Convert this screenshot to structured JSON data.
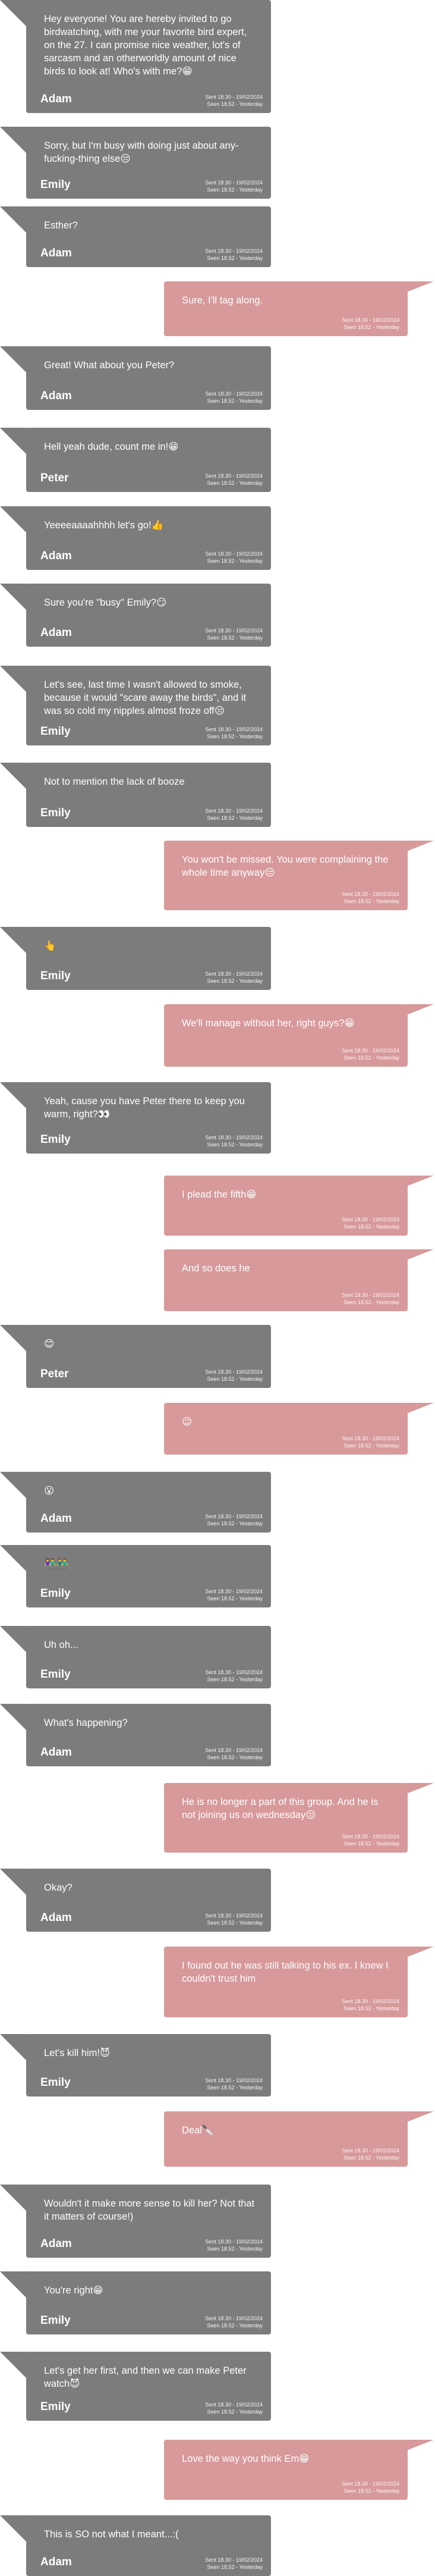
{
  "chat": {
    "messages": [
      {
        "dir": "in",
        "sender": "Adam",
        "text": "Hey everyone! You are hereby invited to go birdwatching, with me your favorite bird expert, on the 27. I can promise nice weather, lot's of sarcasm and an otherworldly amount of nice birds to look at! Who's with me?😁",
        "sent": "Sent 18.30 - 19/02/2024",
        "seen": "Seen 18.52 - Yesterday"
      },
      {
        "dir": "in",
        "sender": "Emily",
        "text": "Sorry, but I'm busy with doing just about any-fucking-thing else😒",
        "sent": "Sent 18.30 - 19/02/2024",
        "seen": "Seen 18.52 - Yesterday"
      },
      {
        "dir": "in",
        "sender": "Adam",
        "text": "Esther?",
        "sent": "Sent 18.30 - 19/02/2024",
        "seen": "Seen 18.52 - Yesterday"
      },
      {
        "dir": "out",
        "sender": "",
        "text": "Sure, I'll tag along.",
        "sent": "Sent 18.30 - 19/02/2024",
        "seen": "Seen 18.52 - Yesterday"
      },
      {
        "dir": "in",
        "sender": "Adam",
        "text": "Great! What about you Peter?",
        "sent": "Sent 18.30 - 19/02/2024",
        "seen": "Seen 18.52 - Yesterday"
      },
      {
        "dir": "in",
        "sender": "Peter",
        "text": "Hell yeah dude, count me in!😁",
        "sent": "Sent 18.30 - 19/02/2024",
        "seen": "Seen 18.52 - Yesterday"
      },
      {
        "dir": "in",
        "sender": "Adam",
        "text": "Yeeeeaaaahhhh let's go!👍",
        "sent": "Sent 18.30 - 19/02/2024",
        "seen": "Seen 18.52 - Yesterday"
      },
      {
        "dir": "in",
        "sender": "Adam",
        "text": "Sure you're \"busy\" Emily?😏",
        "sent": "Sent 18.30 - 19/02/2024",
        "seen": "Seen 18.52 - Yesterday"
      },
      {
        "dir": "in",
        "sender": "Emily",
        "text": "Let's see, last time I wasn't allowed to smoke, because it would \"scare away the birds\", and it was so cold my nipples almost froze off😒",
        "sent": "Sent 18.30 - 19/02/2024",
        "seen": "Seen 18.52 - Yesterday"
      },
      {
        "dir": "in",
        "sender": "Emily",
        "text": "Not to mention the lack of booze",
        "sent": "Sent 18.30 - 19/02/2024",
        "seen": "Seen 18.52 - Yesterday"
      },
      {
        "dir": "out",
        "sender": "",
        "text": "You won't be missed. You were complaining the whole time anyway😒",
        "sent": "Sent 18.30 - 19/02/2024",
        "seen": "Seen 18.52 - Yesterday"
      },
      {
        "dir": "in",
        "sender": "Emily",
        "text": "👆",
        "sent": "Sent 18.30 - 19/02/2024",
        "seen": "Seen 18.52 - Yesterday"
      },
      {
        "dir": "out",
        "sender": "",
        "text": "We'll manage without her, right guys?😁",
        "sent": "Sent 18.30 - 19/02/2024",
        "seen": "Seen 18.52 - Yesterday"
      },
      {
        "dir": "in",
        "sender": "Emily",
        "text": "Yeah, cause you have Peter there to keep you warm, right?👀",
        "sent": "Sent 18.30 - 19/02/2024",
        "seen": "Seen 18.52 - Yesterday"
      },
      {
        "dir": "out",
        "sender": "",
        "text": "I plead the fifth😁",
        "sent": "Sent 18.30 - 19/02/2024",
        "seen": "Seen 18.52 - Yesterday"
      },
      {
        "dir": "out",
        "sender": "",
        "text": "And so does he",
        "sent": "Sent 18.30 - 19/02/2024",
        "seen": "Seen 18.52 - Yesterday"
      },
      {
        "dir": "in",
        "sender": "Peter",
        "text": "😊",
        "sent": "Sent 18.30 - 19/02/2024",
        "seen": "Seen 18.52 - Yesterday"
      },
      {
        "dir": "out",
        "sender": "",
        "text": "😉",
        "sent": "Sent 18.30 - 19/02/2024",
        "seen": "Seen 18.52 - Yesterday"
      },
      {
        "dir": "in",
        "sender": "Adam",
        "text": "😮",
        "sent": "Sent 18.30 - 19/02/2024",
        "seen": "Seen 18.52 - Yesterday"
      },
      {
        "dir": "in",
        "sender": "Emily",
        "text": "👫👬",
        "sent": "Sent 18.30 - 19/02/2024",
        "seen": "Seen 18.52 - Yesterday"
      },
      {
        "dir": "in",
        "sender": "Emily",
        "text": "Uh oh...",
        "sent": "Sent 18.30 - 19/02/2024",
        "seen": "Seen 18.52 - Yesterday"
      },
      {
        "dir": "in",
        "sender": "Adam",
        "text": "What's happening?",
        "sent": "Sent 18.30 - 19/02/2024",
        "seen": "Seen 18.52 - Yesterday"
      },
      {
        "dir": "out",
        "sender": "",
        "text": "He is no longer a part of this group. And he is not joining us on wednesday😒",
        "sent": "Sent 18.30 - 19/02/2024",
        "seen": "Seen 18.52 - Yesterday"
      },
      {
        "dir": "in",
        "sender": "Adam",
        "text": "Okay?",
        "sent": "Sent 18.30 - 19/02/2024",
        "seen": "Seen 18.52 - Yesterday"
      },
      {
        "dir": "out",
        "sender": "",
        "text": "I found out he was still talking to his ex. I knew I couldn't trust him",
        "sent": "Sent 18.30 - 19/02/2024",
        "seen": "Seen 18.52 - Yesterday"
      },
      {
        "dir": "in",
        "sender": "Emily",
        "text": "Let's kill him!😈",
        "sent": "Sent 18.30 - 19/02/2024",
        "seen": "Seen 18.52 - Yesterday"
      },
      {
        "dir": "out",
        "sender": "",
        "text": "Deal🔪",
        "sent": "Sent 18.30 - 19/02/2024",
        "seen": "Seen 18.52 - Yesterday"
      },
      {
        "dir": "in",
        "sender": "Adam",
        "text": "Wouldn't it make more sense to kill her? Not that it matters of course!)",
        "sent": "Sent 18.30 - 19/02/2024",
        "seen": "Seen 18.52 - Yesterday"
      },
      {
        "dir": "in",
        "sender": "Emily",
        "text": "You're right😁",
        "sent": "Sent 18.30 - 19/02/2024",
        "seen": "Seen 18.52 - Yesterday"
      },
      {
        "dir": "in",
        "sender": "Emily",
        "text": "Let's get her first, and then we can make Peter watch😈",
        "sent": "Sent 18.30 - 19/02/2024",
        "seen": "Seen 18.52 - Yesterday"
      },
      {
        "dir": "out",
        "sender": "",
        "text": "Love the way you think Em😁",
        "sent": "Sent 18.30 - 19/02/2024",
        "seen": "Seen 18.52 - Yesterday"
      },
      {
        "dir": "in",
        "sender": "Adam",
        "text": "This is SO not what I meant...:(",
        "sent": "Sent 18.30 - 19/02/2024",
        "seen": "Seen 18.52 - Yesterday"
      }
    ]
  }
}
